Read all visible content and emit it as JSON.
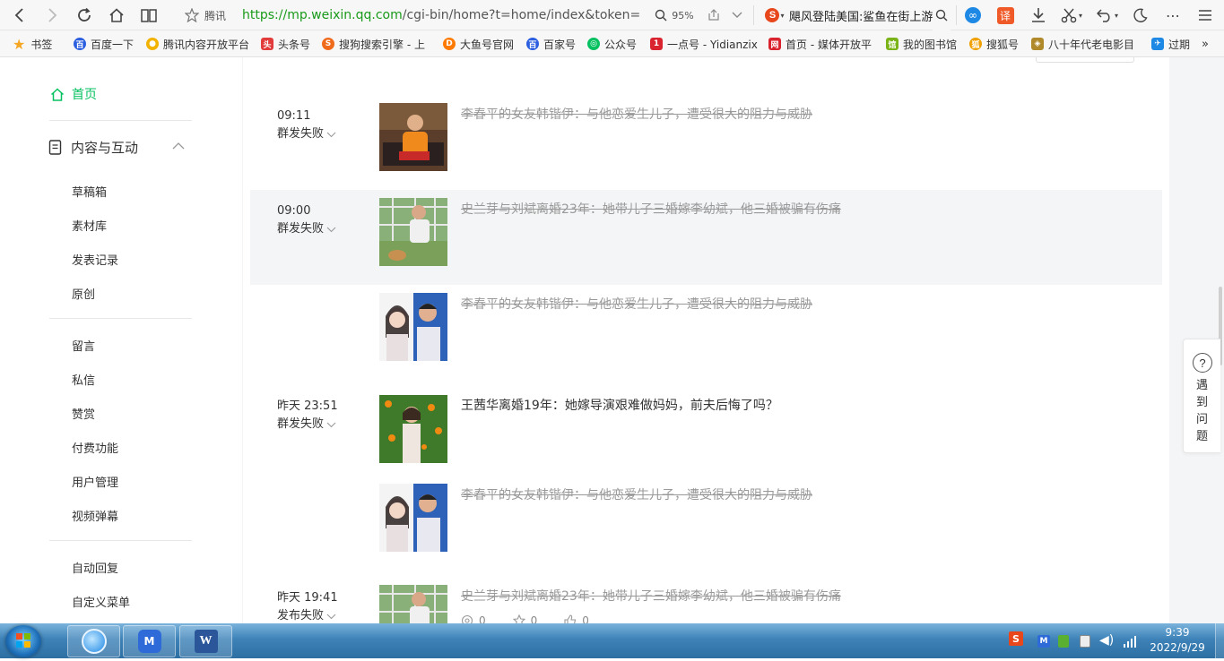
{
  "browser": {
    "site_label": "腾讯",
    "url_scheme_host": "https://mp.weixin.qq.com",
    "url_path": "/cgi-bin/home?t=home/index&token=",
    "zoom": "95%",
    "search_text": "飓风登陆美国:鲨鱼在街上游",
    "icons": [
      "back-icon",
      "forward-icon",
      "reload-icon",
      "home-icon",
      "reader-icon",
      "star-icon",
      "zoom-icon",
      "share-icon",
      "dropdown-icon",
      "search-icon",
      "sogou-icon",
      "translate-icon",
      "download-icon",
      "cut-icon",
      "undo-icon",
      "night-icon",
      "more-icon",
      "menu-icon"
    ]
  },
  "bookmarks": [
    {
      "label": "书签",
      "color": "#f5a623"
    },
    {
      "label": "百度一下",
      "color": "#2b5fe0"
    },
    {
      "label": "腾讯内容开放平台",
      "color": "#f2b200"
    },
    {
      "label": "头条号",
      "color": "#e23b3b"
    },
    {
      "label": "搜狗搜索引擎 - 上",
      "color": "#f06a1c"
    },
    {
      "label": "大鱼号官网",
      "color": "#ff7a00"
    },
    {
      "label": "百家号",
      "color": "#2b5fe0"
    },
    {
      "label": "公众号",
      "color": "#07c160"
    },
    {
      "label": "一点号 - Yidianzix",
      "color": "#d9232e"
    },
    {
      "label": "首页 - 媒体开放平",
      "color": "#d9232e"
    },
    {
      "label": "我的图书馆",
      "color": "#7ab317"
    },
    {
      "label": "搜狐号",
      "color": "#f0a000"
    },
    {
      "label": "八十年代老电影目",
      "color": "#b08a2a"
    },
    {
      "label": "过期",
      "color": "#1e88e5"
    }
  ],
  "sidebar": {
    "home": "首页",
    "group": "内容与互动",
    "items_a": [
      "草稿箱",
      "素材库",
      "发表记录",
      "原创"
    ],
    "items_b": [
      "留言",
      "私信",
      "赞赏",
      "付费功能",
      "用户管理",
      "视频弹幕"
    ],
    "items_c": [
      "自动回复",
      "自定义菜单"
    ]
  },
  "posts": [
    {
      "time": "09:11",
      "status": "群发失败",
      "title": "李春平的女友韩锴伊：与他恋爱生儿子，遭受很大的阻力与威胁",
      "struck": true,
      "highlight": false
    },
    {
      "time": "09:00",
      "status": "群发失败",
      "title": "史兰芽与刘斌离婚23年：她带儿子三婚嫁李幼斌，他三婚被骗有伤痛",
      "struck": true,
      "highlight": true
    },
    {
      "time": "",
      "status": "",
      "title": "李春平的女友韩锴伊：与他恋爱生儿子，遭受很大的阻力与威胁",
      "struck": true,
      "highlight": false
    },
    {
      "time": "昨天 23:51",
      "status": "群发失败",
      "title": "王茜华离婚19年：她嫁导演艰难做妈妈，前夫后悔了吗？",
      "struck": false,
      "highlight": false
    },
    {
      "time": "",
      "status": "",
      "title": "李春平的女友韩锴伊：与他恋爱生儿子，遭受很大的阻力与威胁",
      "struck": true,
      "highlight": false
    },
    {
      "time": "昨天 19:41",
      "status": "发布失败",
      "title": "史兰芽与刘斌离婚23年：她带儿子三婚嫁李幼斌，他三婚被骗有伤痛",
      "struck": true,
      "highlight": false,
      "stats": [
        "0",
        "0",
        "0"
      ]
    }
  ],
  "help": {
    "icon": "?",
    "text": "遇到问题"
  },
  "taskbar": {
    "time": "9:39",
    "date": "2022/9/29",
    "apps": [
      "start-button",
      "browser-app",
      "weixin-app",
      "word-app"
    ]
  }
}
